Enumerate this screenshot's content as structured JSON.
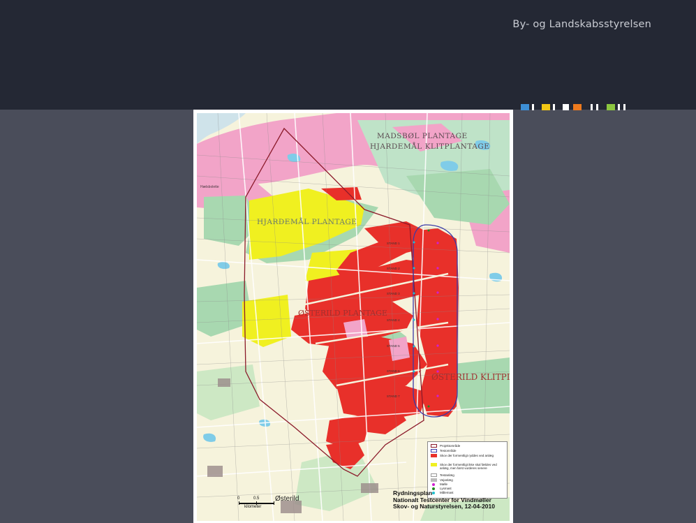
{
  "header": {
    "org_name": "By- og Landskabsstyrelsen"
  },
  "color_strip": [
    "#3d8fd6",
    "#f2c614",
    "#ffffff",
    "#ed7a1e",
    "#ffffff",
    "#8cc63f",
    "#ffffff"
  ],
  "map": {
    "place_labels": {
      "madsbol": "MADSBØL PLANTAGE",
      "hjardemal_klit": "HJARDEMÅL KLITPLANTAGE",
      "hjardemal_plantage": "HJARDEMÅL PLANTAGE",
      "osterild_plantage": "ØSTERILD PLANTAGE",
      "osterild_klit": "ØSTERILD KLITPLANTAGE",
      "osterild_town": "Østerild",
      "haelsbolette": "Hælsbolette"
    },
    "stands": [
      "STAND 1",
      "STAND 2",
      "STAND 3",
      "STAND 4",
      "STAND 5",
      "STAND 6",
      "STAND 7"
    ],
    "legend": {
      "items": [
        {
          "label": "Projektområde",
          "color": "#8b1a2a",
          "kind": "outline"
        },
        {
          "label": "Testområde",
          "color": "#3a3aa8",
          "kind": "outline"
        },
        {
          "label": "Skov der formentligt ryddes ved anlæg",
          "color": "#e8302a",
          "kind": "fill"
        },
        {
          "label": "Skov der formentligt ikke skal fældes ved anlæg, men først vurderes senere",
          "color": "#f0f020",
          "kind": "fill"
        },
        {
          "label": "Testanlæg",
          "color": "#ffffff",
          "kind": "outline"
        },
        {
          "label": "Vejanlæg",
          "color": "#bbbbbb",
          "kind": "fill"
        },
        {
          "label": "Mølle",
          "color": "#d020d0",
          "kind": "dot"
        },
        {
          "label": "Lysmast",
          "color": "#208a20",
          "kind": "dot"
        },
        {
          "label": "Målemast",
          "color": "#20c0d0",
          "kind": "dot"
        }
      ]
    },
    "title_lines": [
      "Rydningsplan",
      "Nationalt Testcenter for Vindmøller",
      "Skov- og Naturstyrelsen, 12-04-2010"
    ],
    "scale": {
      "zero": "0",
      "mid": "0.5",
      "unit": "kilometer"
    }
  }
}
